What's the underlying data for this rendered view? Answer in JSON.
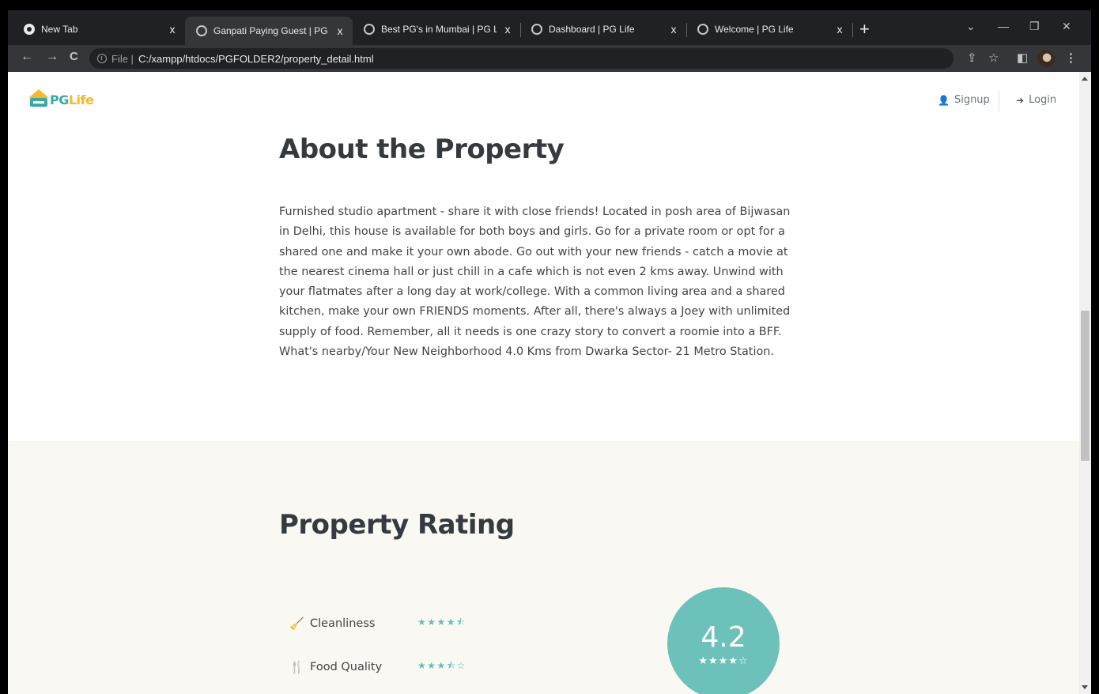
{
  "browser": {
    "tabs": [
      {
        "title": "New Tab",
        "close": "x",
        "favicon": "chrome-icon"
      },
      {
        "title": "Ganpati Paying Guest | PG Life",
        "close": "x",
        "favicon": "globe-icon",
        "active": true
      },
      {
        "title": "Best PG's in Mumbai | PG Life",
        "close": "x",
        "favicon": "globe-icon"
      },
      {
        "title": "Dashboard | PG Life",
        "close": "x",
        "favicon": "globe-icon"
      },
      {
        "title": "Welcome | PG Life",
        "close": "x",
        "favicon": "globe-icon"
      }
    ],
    "new_tab": "+",
    "window_controls": {
      "tab_search": "⌄",
      "minimize": "—",
      "restore": "❐",
      "close": "✕"
    },
    "nav": {
      "back": "←",
      "forward": "→",
      "reload": "C"
    },
    "address": {
      "scheme": "File |",
      "url": "C:/xampp/htdocs/PGFOLDER2/property_detail.html"
    },
    "toolbar_icons": {
      "share": "⇪",
      "bookmark": "☆",
      "side_panel": "◧",
      "menu": "⋮"
    }
  },
  "header": {
    "logo": {
      "pg": "PG",
      "life": "Life"
    },
    "signup": {
      "icon": "👤",
      "label": "Signup"
    },
    "login": {
      "icon": "➜",
      "label": "Login"
    }
  },
  "about": {
    "title": "About the Property",
    "text": "Furnished studio apartment - share it with close friends! Located in posh area of Bijwasan in Delhi, this house is available for both boys and girls. Go for a private room or opt for a shared one and make it your own abode. Go out with your new friends - catch a movie at the nearest cinema hall or just chill in a cafe which is not even 2 kms away. Unwind with your flatmates after a long day at work/college. With a common living area and a shared kitchen, make your own FRIENDS moments. After all, there's always a Joey with unlimited supply of food. Remember, all it needs is one crazy story to convert a roomie into a BFF. What's nearby/Your New Neighborhood 4.0 Kms from Dwarka Sector- 21 Metro Station."
  },
  "rating": {
    "title": "Property Rating",
    "items": [
      {
        "icon": "🧹",
        "label": "Cleanliness",
        "stars": "★★★★⯪"
      },
      {
        "icon": "🍴",
        "label": "Food Quality",
        "stars": "★★★⯪☆"
      }
    ],
    "overall": {
      "value": "4.2",
      "stars": "★★★★☆"
    }
  },
  "colors": {
    "accent": "#6cc2bb",
    "logo_yellow": "#f5b82e",
    "logo_teal": "#3aa9a3",
    "section_bg": "#f9f8f3"
  }
}
